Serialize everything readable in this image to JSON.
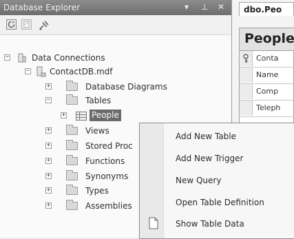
{
  "explorer": {
    "title": "Database Explorer",
    "title_buttons": [
      "▾",
      "⊥",
      "✕"
    ],
    "toolbar_icons": [
      "refresh-icon",
      "stop-icon",
      "connect-icon"
    ]
  },
  "tree": {
    "data_connections": "Data Connections",
    "database": "ContactDB.mdf",
    "database_diagrams": "Database Diagrams",
    "tables": "Tables",
    "people": "People",
    "views": "Views",
    "stored_procs": "Stored Proc",
    "functions": "Functions",
    "synonyms": "Synonyms",
    "types": "Types",
    "assemblies": "Assemblies",
    "expand_symbol": "+",
    "collapse_symbol": "−"
  },
  "document": {
    "tab_title": "dbo.Peo",
    "table_title": "People",
    "rows": [
      "Conta",
      "Name",
      "Comp",
      "Teleph"
    ]
  },
  "context_menu": {
    "items": [
      "Add New Table",
      "Add New Trigger",
      "New Query",
      "Open Table Definition",
      "Show Table Data"
    ]
  }
}
